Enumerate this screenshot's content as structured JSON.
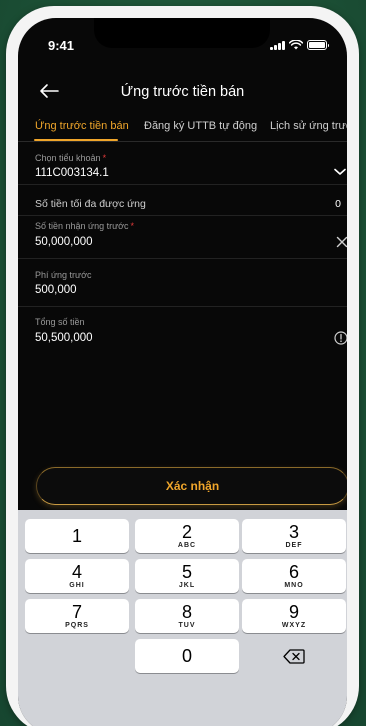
{
  "status": {
    "time": "9:41"
  },
  "header": {
    "title": "Ứng trước tiền bán"
  },
  "tabs": [
    {
      "label": "Ứng trước tiền bán",
      "active": true
    },
    {
      "label": "Đăng ký UTTB tự động",
      "active": false
    },
    {
      "label": "Lịch sử ứng trước",
      "active": false
    }
  ],
  "form": {
    "account_label": "Chọn tiểu khoản",
    "account_value": "111C003134.1",
    "max_label": "Số tiền tối đa được ứng",
    "max_value": "0",
    "amount_label": "Số tiền nhận ứng trước",
    "amount_value": "50,000,000",
    "fee_label": "Phí ứng trước",
    "fee_value": "500,000",
    "total_label": "Tổng số tiền",
    "total_value": "50,500,000"
  },
  "confirm_label": "Xác nhận",
  "keypad": [
    {
      "num": "1",
      "letters": ""
    },
    {
      "num": "2",
      "letters": "ABC"
    },
    {
      "num": "3",
      "letters": "DEF"
    },
    {
      "num": "4",
      "letters": "GHI"
    },
    {
      "num": "5",
      "letters": "JKL"
    },
    {
      "num": "6",
      "letters": "MNO"
    },
    {
      "num": "7",
      "letters": "PQRS"
    },
    {
      "num": "8",
      "letters": "TUV"
    },
    {
      "num": "9",
      "letters": "WXYZ"
    },
    {
      "num": "0",
      "letters": ""
    }
  ],
  "colors": {
    "accent": "#f0a62b",
    "required": "#e23a3a",
    "background": "#080808"
  }
}
